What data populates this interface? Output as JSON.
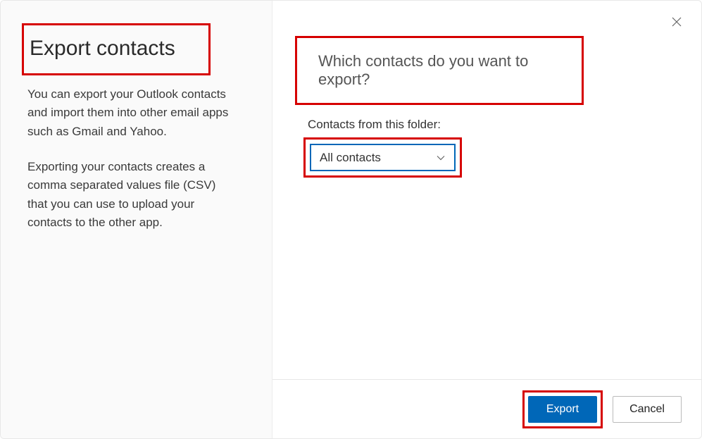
{
  "left": {
    "title": "Export contacts",
    "desc1": "You can export your Outlook contacts and import them into other email apps such as Gmail and Yahoo.",
    "desc2": "Exporting your contacts creates a comma separated values file (CSV) that you can use to upload your contacts to the other app."
  },
  "right": {
    "question": "Which contacts do you want to export?",
    "folder_label": "Contacts from this folder:",
    "folder_value": "All contacts"
  },
  "footer": {
    "export_label": "Export",
    "cancel_label": "Cancel"
  },
  "highlights": {
    "color": "#d60000"
  }
}
